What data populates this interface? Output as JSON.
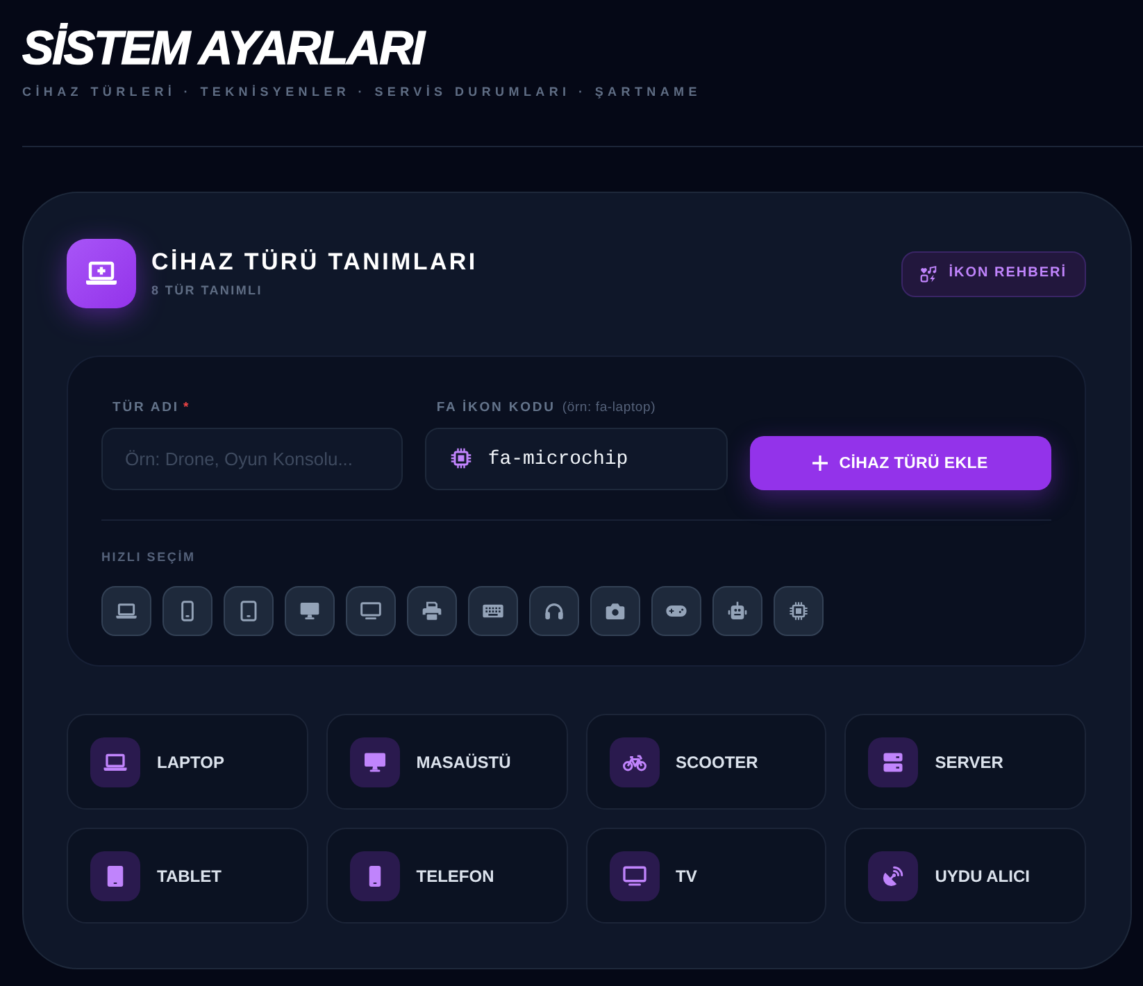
{
  "page": {
    "title": "SİSTEM AYARLARI",
    "subtitle": "CİHAZ TÜRLERİ · TEKNİSYENLER · SERVİS DURUMLARI · ŞARTNAME"
  },
  "panel": {
    "title": "CİHAZ TÜRÜ TANIMLARI",
    "count": "8 TÜR TANIMLI",
    "guide_button": "İKON REHBERİ"
  },
  "form": {
    "name_field": {
      "label": "TÜR ADI",
      "required_mark": "*",
      "placeholder": "Örn: Drone, Oyun Konsolu..."
    },
    "icon_field": {
      "label": "FA İKON KODU",
      "hint": "(örn: fa-laptop)",
      "value": "fa-microchip",
      "kind": "microchip"
    },
    "add_button": "CİHAZ TÜRÜ EKLE"
  },
  "quick_pick": {
    "label": "HIZLI SEÇİM",
    "items": [
      {
        "kind": "laptop"
      },
      {
        "kind": "mobile"
      },
      {
        "kind": "tablet"
      },
      {
        "kind": "desktop"
      },
      {
        "kind": "tv"
      },
      {
        "kind": "printer"
      },
      {
        "kind": "keyboard"
      },
      {
        "kind": "headphones"
      },
      {
        "kind": "camera"
      },
      {
        "kind": "gamepad"
      },
      {
        "kind": "robot"
      },
      {
        "kind": "microchip"
      }
    ]
  },
  "device_types": [
    {
      "name": "LAPTOP",
      "kind": "laptop"
    },
    {
      "name": "MASAÜSTÜ",
      "kind": "desktop"
    },
    {
      "name": "SCOOTER",
      "kind": "bicycle"
    },
    {
      "name": "SERVER",
      "kind": "server"
    },
    {
      "name": "TABLET",
      "kind": "tablet"
    },
    {
      "name": "TELEFON",
      "kind": "mobile"
    },
    {
      "name": "TV",
      "kind": "tv"
    },
    {
      "name": "UYDU ALICI",
      "kind": "satellite"
    }
  ]
}
